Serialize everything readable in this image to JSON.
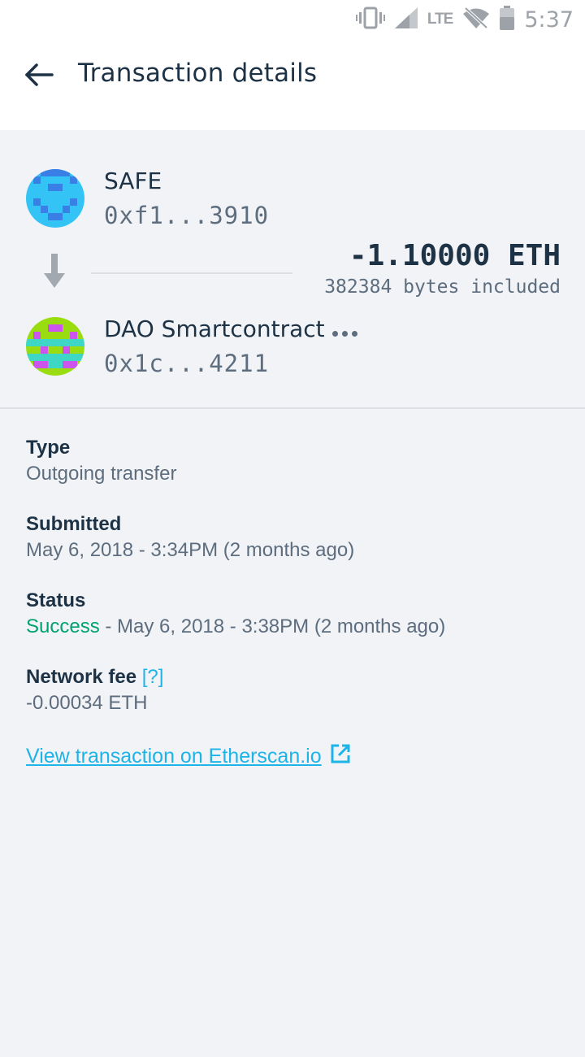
{
  "status_bar": {
    "time": "5:37",
    "network": "LTE",
    "icons": [
      "vibrate-icon",
      "signal-icon",
      "wifi-off-icon",
      "battery-icon"
    ]
  },
  "header": {
    "title": "Transaction details",
    "back_icon": "arrow-left-icon"
  },
  "transaction": {
    "sender": {
      "name": "SAFE",
      "address": "0xf1...3910"
    },
    "recipient": {
      "name": "DAO Smartcontract",
      "address": "0x1c...4211"
    },
    "amount": "-1.10000 ETH",
    "data_size": "382384 bytes included"
  },
  "details": {
    "type": {
      "label": "Type",
      "value": "Outgoing transfer"
    },
    "submitted": {
      "label": "Submitted",
      "value": "May 6, 2018 - 3:34PM (2 months ago)"
    },
    "status": {
      "label": "Status",
      "state": "Success",
      "value": " - May 6, 2018 - 3:38PM (2 months ago)"
    },
    "network_fee": {
      "label": "Network fee",
      "help": "[?]",
      "value": "-0.00034 ETH"
    }
  },
  "etherscan_link": "View transaction on Etherscan.io",
  "colors": {
    "primary_text": "#1d3245",
    "secondary_text": "#5d6d7e",
    "link": "#1db4e8",
    "success": "#00a26d",
    "background": "#f1f3f7"
  }
}
